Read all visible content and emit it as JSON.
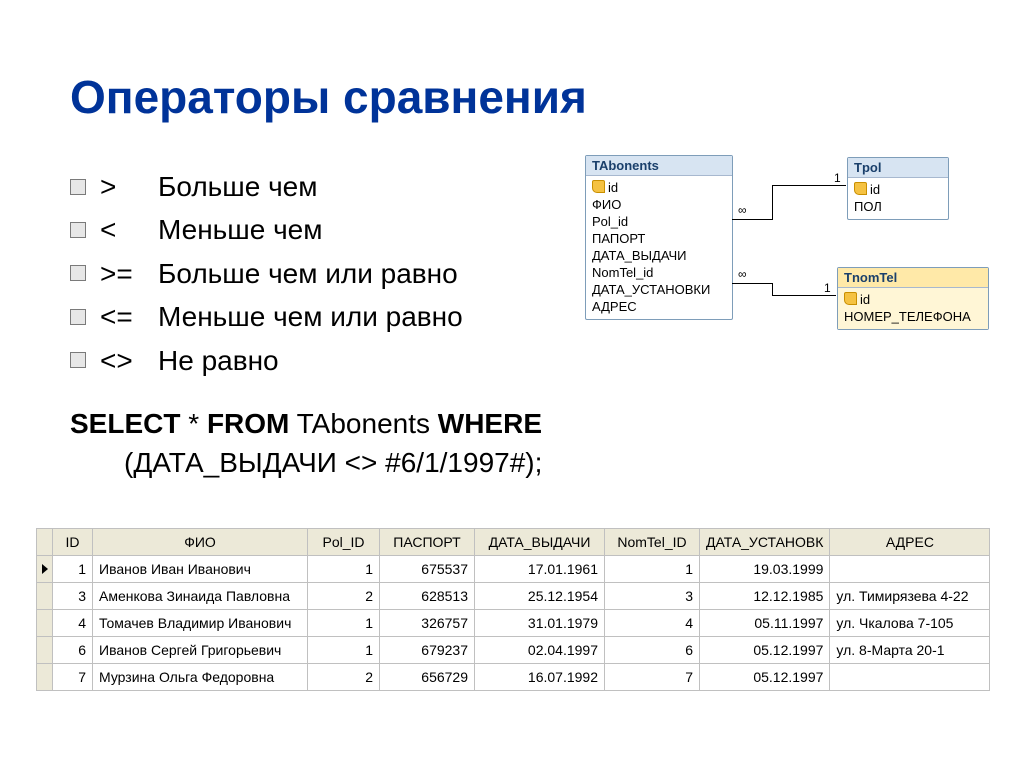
{
  "title": "Операторы сравнения",
  "bullets": [
    {
      "op": ">",
      "desc": "Больше чем"
    },
    {
      "op": "<",
      "desc": "Меньше чем"
    },
    {
      "op": ">=",
      "desc": "Больше чем или равно"
    },
    {
      "op": "<=",
      "desc": "Меньше чем или равно"
    },
    {
      "op": "<>",
      "desc": "Не равно"
    }
  ],
  "sql": {
    "kw_select": "SELECT",
    "star": " * ",
    "kw_from": "FROM",
    "table": " TAbonents ",
    "kw_where": "WHERE",
    "line2": "(ДАТА_ВЫДАЧИ <> #6/1/1997#);"
  },
  "rel": {
    "tabonents": {
      "title": "TAbonents",
      "fields": [
        "id",
        "ФИО",
        "Pol_id",
        "ПАПОРТ",
        "ДАТА_ВЫДАЧИ",
        "NomTel_id",
        "ДАТА_УСТАНОВКИ",
        "АДРЕС"
      ],
      "key_index": 0
    },
    "tpol": {
      "title": "Tpol",
      "fields": [
        "id",
        "ПОЛ"
      ],
      "key_index": 0
    },
    "tnomtel": {
      "title": "TnomTel",
      "fields": [
        "id",
        "НОМЕР_ТЕЛЕФОНА"
      ],
      "key_index": 0
    },
    "join_labels": {
      "many": "∞",
      "one": "1"
    }
  },
  "table": {
    "headers": [
      "ID",
      "ФИО",
      "Pol_ID",
      "ПАСПОРТ",
      "ДАТА_ВЫДАЧИ",
      "NomTel_ID",
      "ДАТА_УСТАНОВК",
      "АДРЕС"
    ],
    "rows": [
      {
        "id": "1",
        "fio": "Иванов Иван Иванович",
        "pol": "1",
        "pass": "675537",
        "dvy": "17.01.1961",
        "ntel": "1",
        "dust": "19.03.1999",
        "addr": ""
      },
      {
        "id": "3",
        "fio": "Аменкова Зинаида Павловна",
        "pol": "2",
        "pass": "628513",
        "dvy": "25.12.1954",
        "ntel": "3",
        "dust": "12.12.1985",
        "addr": "ул. Тимирязева 4-22"
      },
      {
        "id": "4",
        "fio": "Томачев Владимир Иванович",
        "pol": "1",
        "pass": "326757",
        "dvy": "31.01.1979",
        "ntel": "4",
        "dust": "05.11.1997",
        "addr": "ул. Чкалова 7-105"
      },
      {
        "id": "6",
        "fio": "Иванов Сергей Григорьевич",
        "pol": "1",
        "pass": "679237",
        "dvy": "02.04.1997",
        "ntel": "6",
        "dust": "05.12.1997",
        "addr": "ул. 8-Марта 20-1"
      },
      {
        "id": "7",
        "fio": "Мурзина Ольга Федоровна",
        "pol": "2",
        "pass": "656729",
        "dvy": "16.07.1992",
        "ntel": "7",
        "dust": "05.12.1997",
        "addr": ""
      }
    ]
  }
}
